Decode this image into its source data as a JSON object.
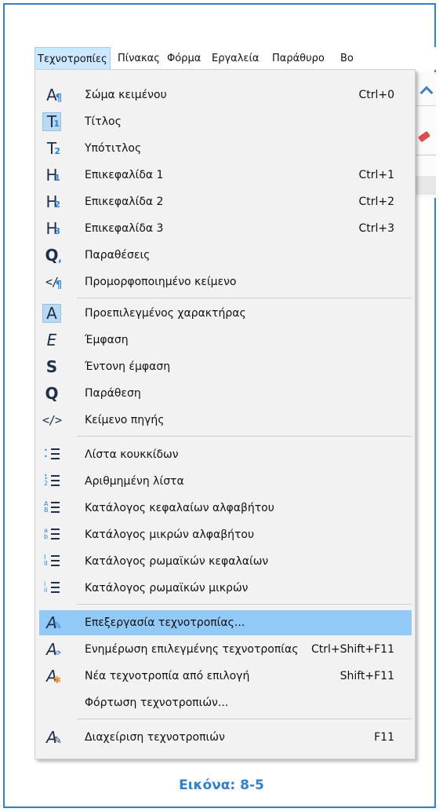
{
  "menubar": {
    "items": [
      "Τεχνοτροπίες",
      "Πίνακας",
      "Φόρμα",
      "Εργαλεία",
      "Παράθυρο",
      "Βο"
    ]
  },
  "menu": {
    "items": [
      {
        "label": "Σώμα κειμένου",
        "shortcut": "Ctrl+0",
        "icon": "text-body-icon"
      },
      {
        "label": "Τίτλος",
        "shortcut": "",
        "icon": "title-icon"
      },
      {
        "label": "Υπότιτλος",
        "shortcut": "",
        "icon": "subtitle-icon"
      },
      {
        "label": "Επικεφαλίδα 1",
        "shortcut": "Ctrl+1",
        "icon": "heading-1-icon"
      },
      {
        "label": "Επικεφαλίδα 2",
        "shortcut": "Ctrl+2",
        "icon": "heading-2-icon"
      },
      {
        "label": "Επικεφαλίδα 3",
        "shortcut": "Ctrl+3",
        "icon": "heading-3-icon"
      },
      {
        "label": "Παραθέσεις",
        "shortcut": "",
        "icon": "quotations-icon"
      },
      {
        "label": "Προμορφοποιημένο κείμενο",
        "shortcut": "",
        "icon": "preformatted-text-icon"
      },
      {
        "label": "Προεπιλεγμένος χαρακτήρας",
        "shortcut": "",
        "icon": "default-character-icon"
      },
      {
        "label": "Έμφαση",
        "shortcut": "",
        "icon": "emphasis-icon"
      },
      {
        "label": "Έντονη έμφαση",
        "shortcut": "",
        "icon": "strong-emphasis-icon"
      },
      {
        "label": "Παράθεση",
        "shortcut": "",
        "icon": "quotation-icon"
      },
      {
        "label": "Κείμενο πηγής",
        "shortcut": "",
        "icon": "source-text-icon"
      },
      {
        "label": "Λίστα κουκκίδων",
        "shortcut": "",
        "icon": "bullet-list-icon"
      },
      {
        "label": "Αριθμημένη λίστα",
        "shortcut": "",
        "icon": "numbered-list-icon"
      },
      {
        "label": "Κατάλογος κεφαλαίων αλφαβήτου",
        "shortcut": "",
        "icon": "uppercase-alpha-list-icon"
      },
      {
        "label": "Κατάλογος μικρών αλφαβήτου",
        "shortcut": "",
        "icon": "lowercase-alpha-list-icon"
      },
      {
        "label": "Κατάλογος ρωμαϊκών κεφαλαίων",
        "shortcut": "",
        "icon": "uppercase-roman-list-icon"
      },
      {
        "label": "Κατάλογος ρωμαϊκών μικρών",
        "shortcut": "",
        "icon": "lowercase-roman-list-icon"
      },
      {
        "label": "Επεξεργασία τεχνοτροπίας...",
        "shortcut": "",
        "icon": "edit-style-icon"
      },
      {
        "label": "Ενημέρωση επιλεγμένης τεχνοτροπίας",
        "shortcut": "Ctrl+Shift+F11",
        "icon": "update-style-icon"
      },
      {
        "label": "Νέα τεχνοτροπία από επιλογή",
        "shortcut": "Shift+F11",
        "icon": "new-style-icon"
      },
      {
        "label": "Φόρτωση τεχνοτροπιών...",
        "shortcut": "",
        "icon": ""
      },
      {
        "label": "Διαχείριση τεχνοτροπιών",
        "shortcut": "F11",
        "icon": "manage-styles-icon"
      }
    ]
  },
  "caption": "Εικόνα: 8-5",
  "colors": {
    "frame_border": "#2e7fd6",
    "menu_background": "#f2f2f2",
    "selected_item": "#91c9f7",
    "active_menubar": "#cce8ff",
    "caption_text": "#2e7fd6"
  }
}
